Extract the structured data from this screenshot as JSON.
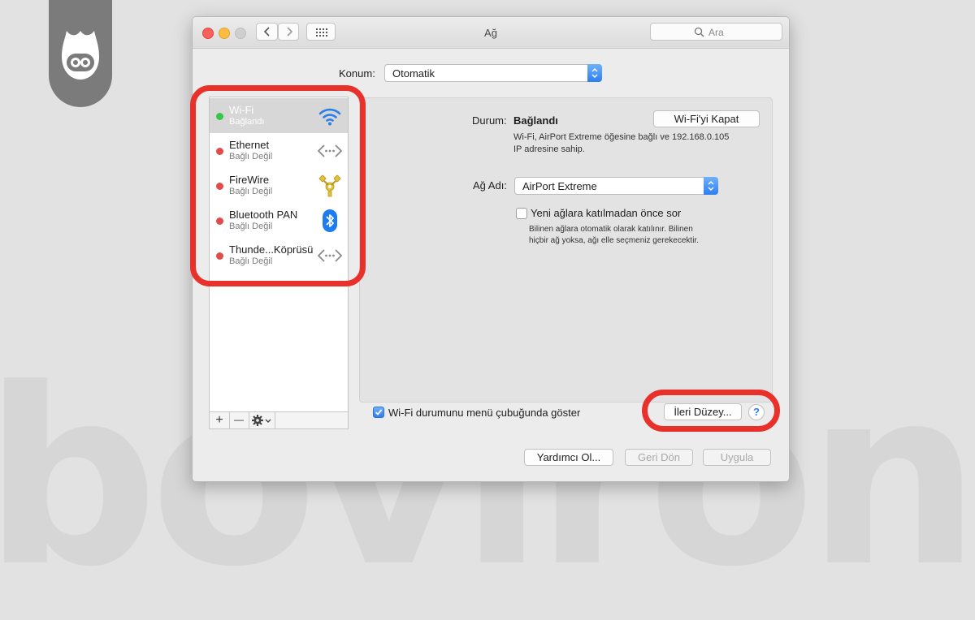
{
  "watermark": "boviron",
  "window": {
    "title": "Ağ",
    "search_placeholder": "Ara"
  },
  "location": {
    "label": "Konum:",
    "value": "Otomatik"
  },
  "sidebar": {
    "items": [
      {
        "name": "Wi-Fi",
        "status": "Bağlandı",
        "status_color": "#34c84a",
        "icon": "wifi-icon",
        "selected": true
      },
      {
        "name": "Ethernet",
        "status": "Bağlı Değil",
        "status_color": "#e34b4b",
        "icon": "ethernet-icon",
        "selected": false
      },
      {
        "name": "FireWire",
        "status": "Bağlı Değil",
        "status_color": "#e34b4b",
        "icon": "firewire-icon",
        "selected": false
      },
      {
        "name": "Bluetooth PAN",
        "status": "Bağlı Değil",
        "status_color": "#e34b4b",
        "icon": "bluetooth-icon",
        "selected": false
      },
      {
        "name": "Thunde...Köprüsü",
        "status": "Bağlı Değil",
        "status_color": "#e34b4b",
        "icon": "thunderbolt-bridge-icon",
        "selected": false
      }
    ],
    "toolbar": {
      "add": "+",
      "remove": "—"
    }
  },
  "detail": {
    "status_label": "Durum:",
    "status_value": "Bağlandı",
    "wifi_off_button": "Wi-Fi'yi Kapat",
    "status_desc_line1": "Wi-Fi, AirPort Extreme öğesine bağlı ve 192.168.0.105",
    "status_desc_line2": "IP adresine sahip.",
    "network_label": "Ağ Adı:",
    "network_value": "AirPort Extreme",
    "ask_join_label": "Yeni ağlara katılmadan önce sor",
    "ask_join_checked": false,
    "ask_join_desc_line1": "Bilinen ağlara otomatik olarak katılınır. Bilinen",
    "ask_join_desc_line2": "hiçbir ağ yoksa, ağı elle seçmeniz gerekecektir."
  },
  "footer": {
    "show_in_menu_label": "Wi-Fi durumunu menü çubuğunda göster",
    "show_in_menu_checked": true,
    "advanced_button": "İleri Düzey...",
    "help_button": "?",
    "assist_button": "Yardımcı Ol...",
    "revert_button": "Geri Dön",
    "apply_button": "Uygula"
  },
  "colors": {
    "highlight": "#e8312b",
    "accent": "#2f7df0"
  }
}
